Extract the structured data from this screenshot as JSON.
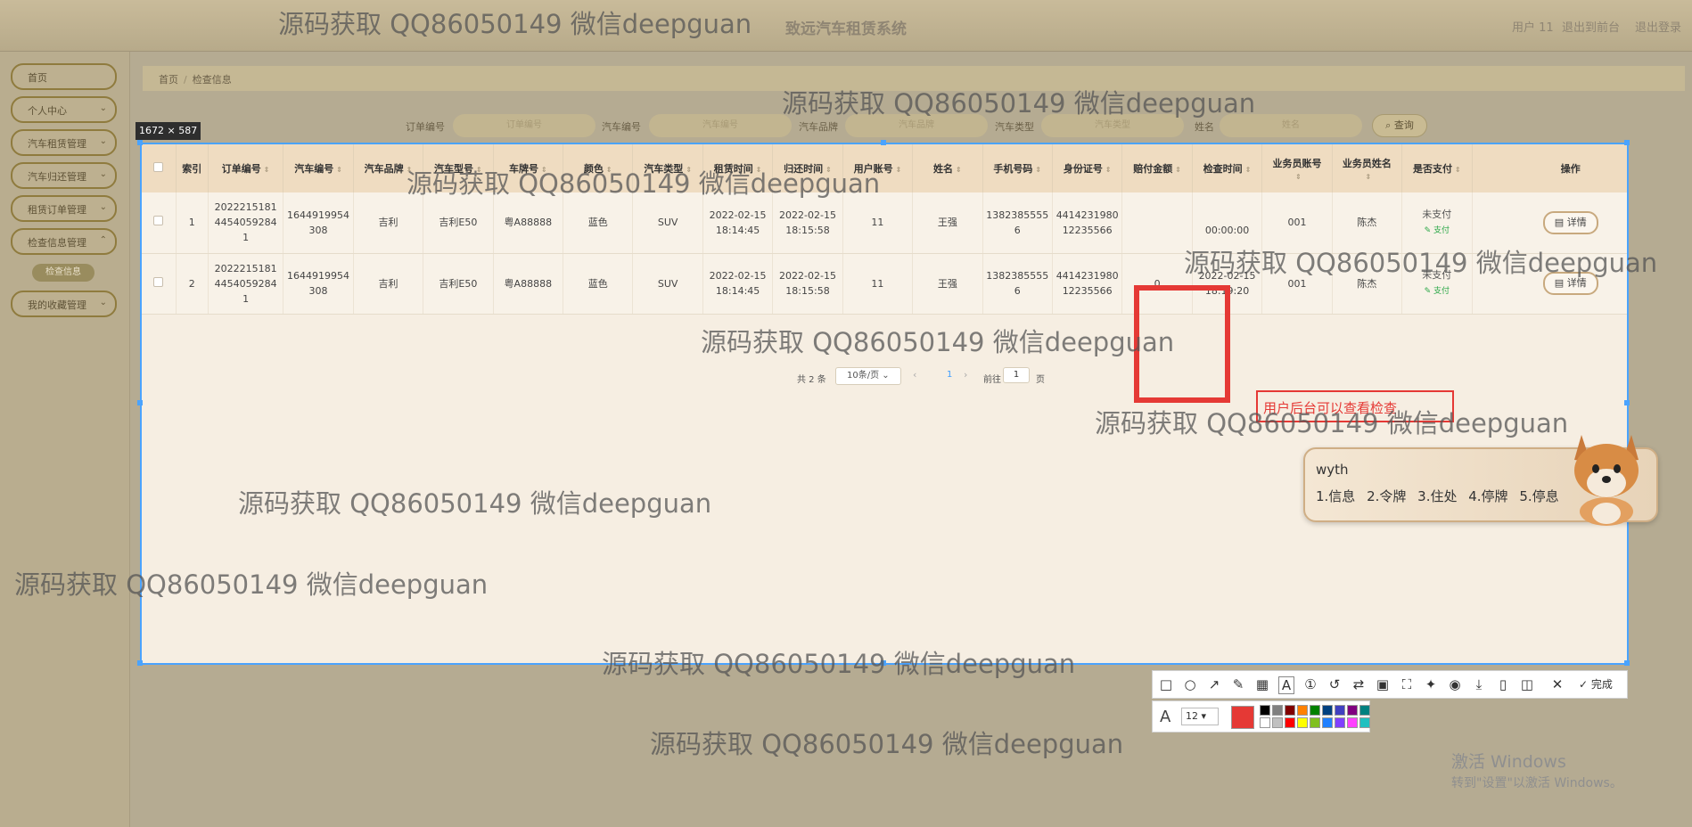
{
  "header": {
    "system_title": "致远汽车租赁系统",
    "user_label": "用户 11",
    "logout_to_front": "退出到前台",
    "logout": "退出登录"
  },
  "sidebar": {
    "items": [
      {
        "label": "首页",
        "has_chevron": false
      },
      {
        "label": "个人中心",
        "has_chevron": true
      },
      {
        "label": "汽车租赁管理",
        "has_chevron": true
      },
      {
        "label": "汽车归还管理",
        "has_chevron": true
      },
      {
        "label": "租赁订单管理",
        "has_chevron": true
      },
      {
        "label": "检查信息管理",
        "has_chevron": true
      },
      {
        "label": "我的收藏管理",
        "has_chevron": true
      }
    ],
    "sub_item": "检查信息"
  },
  "breadcrumb": {
    "home": "首页",
    "separator": "/",
    "current": "检查信息"
  },
  "search": {
    "fields": [
      {
        "label": "订单编号",
        "placeholder": "订单编号"
      },
      {
        "label": "汽车编号",
        "placeholder": "汽车编号"
      },
      {
        "label": "汽车品牌",
        "placeholder": "汽车品牌"
      },
      {
        "label": "汽车类型",
        "placeholder": "汽车类型"
      },
      {
        "label": "姓名",
        "placeholder": "姓名"
      }
    ],
    "button": "查询",
    "search_icon": "search-icon"
  },
  "selection": {
    "size_label": "1672 × 587",
    "border_color": "#4aa3ff"
  },
  "table": {
    "columns": [
      "索引",
      "订单编号",
      "汽车编号",
      "汽车品牌",
      "汽车型号",
      "车牌号",
      "颜色",
      "汽车类型",
      "租赁时间",
      "归还时间",
      "用户账号",
      "姓名",
      "手机号码",
      "身份证号",
      "赔付金额",
      "检查时间",
      "业务员账号",
      "业务员姓名",
      "是否支付",
      "操作"
    ],
    "rows": [
      {
        "index": "1",
        "order_no": [
          "2022215181",
          "4454059284",
          "1"
        ],
        "car_no": [
          "1644919954",
          "308"
        ],
        "brand": "吉利",
        "model": "吉利E50",
        "plate": "粤A88888",
        "color": "蓝色",
        "type": "SUV",
        "rent_time": [
          "2022-02-15",
          "18:14:45"
        ],
        "return_time": [
          "2022-02-15",
          "18:15:58"
        ],
        "user": "11",
        "name": "王强",
        "phone": [
          "1382385555",
          "6"
        ],
        "id_card": [
          "4414231980",
          "12235566"
        ],
        "compensation": "",
        "check_time": [
          "",
          "00:00:00"
        ],
        "clerk_account": "001",
        "clerk_name": "陈杰",
        "paid": "未支付",
        "pay_link": "支付",
        "action": "详情"
      },
      {
        "index": "2",
        "order_no": [
          "2022215181",
          "4454059284",
          "1"
        ],
        "car_no": [
          "1644919954",
          "308"
        ],
        "brand": "吉利",
        "model": "吉利E50",
        "plate": "粤A88888",
        "color": "蓝色",
        "type": "SUV",
        "rent_time": [
          "2022-02-15",
          "18:14:45"
        ],
        "return_time": [
          "2022-02-15",
          "18:15:58"
        ],
        "user": "11",
        "name": "王强",
        "phone": [
          "1382385555",
          "6"
        ],
        "id_card": [
          "4414231980",
          "12235566"
        ],
        "compensation": "0",
        "check_time": [
          "2022-02-15",
          "18:19:20"
        ],
        "clerk_account": "001",
        "clerk_name": "陈杰",
        "paid": "未支付",
        "pay_link": "支付",
        "action": "详情"
      }
    ]
  },
  "pagination": {
    "total": "共 2 条",
    "page_size": "10条/页",
    "current_page": "1",
    "goto_label": "前往",
    "goto_value": "1",
    "page_unit": "页"
  },
  "annotation": {
    "note": "用户后台可以查看检查",
    "color": "#e53935"
  },
  "ime": {
    "input": "wyth",
    "candidates": "1.信息 2.令牌 3.住处 4.停牌 5.停息"
  },
  "watermark": "源码获取 QQ86050149 微信deepguan",
  "toolbar": {
    "tools": [
      "rectangle-icon",
      "ellipse-icon",
      "arrow-icon",
      "pencil-icon",
      "mosaic-icon",
      "text-icon",
      "sequence-icon",
      "undo-icon",
      "translate-icon",
      "ocr-icon",
      "long-screenshot-icon",
      "pin-icon",
      "record-icon",
      "save-icon",
      "copy-icon",
      "bookmark-icon",
      "close-icon"
    ],
    "done_label": "完成",
    "font_size": "12",
    "current_color": "#e53935",
    "palette": [
      "#000000",
      "#808080",
      "#800000",
      "#ff8000",
      "#008000",
      "#004080",
      "#4040c0",
      "#800080",
      "#008080",
      "#ffffff",
      "#c0c0c0",
      "#ff0000",
      "#ffff00",
      "#80c020",
      "#2080ff",
      "#8040ff",
      "#ff40ff",
      "#20c0c0"
    ]
  },
  "windows": {
    "line1": "激活 Windows",
    "line2": "转到\"设置\"以激活 Windows。"
  }
}
